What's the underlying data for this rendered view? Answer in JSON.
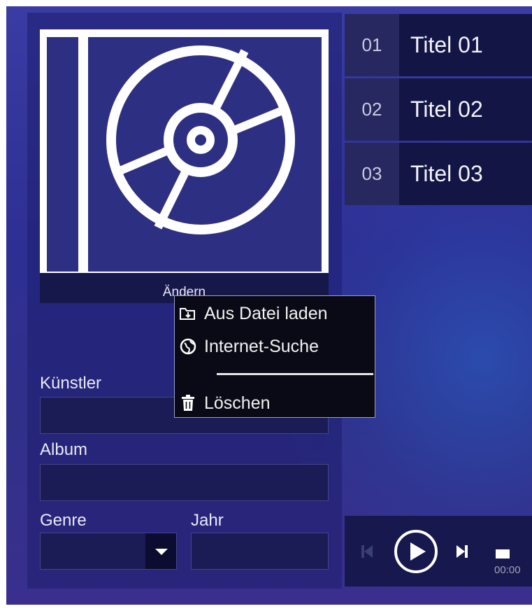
{
  "cover": {
    "change_label": "Ändern"
  },
  "context_menu": {
    "items": [
      {
        "label": "Aus Datei laden",
        "icon": "folder-open-icon"
      },
      {
        "label": "Internet-Suche",
        "icon": "globe-icon"
      },
      {
        "label": "Löschen",
        "icon": "trash-icon"
      }
    ]
  },
  "form": {
    "artist_label": "Künstler",
    "artist_value": "",
    "album_label": "Album",
    "album_value": "",
    "genre_label": "Genre",
    "genre_value": "",
    "year_label": "Jahr",
    "year_value": ""
  },
  "tracks": [
    {
      "number": "01",
      "title": "Titel 01"
    },
    {
      "number": "02",
      "title": "Titel 02"
    },
    {
      "number": "03",
      "title": "Titel 03"
    }
  ],
  "player": {
    "time": "00:00",
    "icons": [
      "previous-icon",
      "play-icon",
      "next-icon",
      "stop-icon"
    ]
  },
  "colors": {
    "background": "#2e2f94",
    "panel": "#17184d",
    "accent": "#ffffff"
  }
}
